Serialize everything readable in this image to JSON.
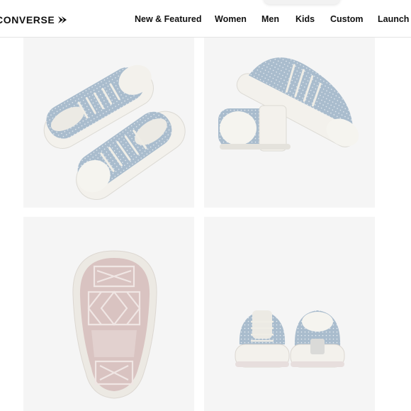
{
  "brand": {
    "logo_text": "CONVERSE",
    "logo_icon": "chevron-star-icon"
  },
  "nav": {
    "items": [
      {
        "label": "New & Featured"
      },
      {
        "label": "Women"
      },
      {
        "label": "Men"
      },
      {
        "label": "Kids"
      },
      {
        "label": "Custom"
      },
      {
        "label": "Launch"
      }
    ]
  },
  "gallery": {
    "images": [
      {
        "name": "pair-top-view"
      },
      {
        "name": "pair-side-view"
      },
      {
        "name": "outsole-view"
      },
      {
        "name": "heel-back-view"
      }
    ]
  },
  "colors": {
    "canvas_denim": "#a9bccd",
    "rubber_white": "#f3f1ec",
    "outsole_pink": "#d9c3c1",
    "tile_bg": "#f5f5f5"
  }
}
